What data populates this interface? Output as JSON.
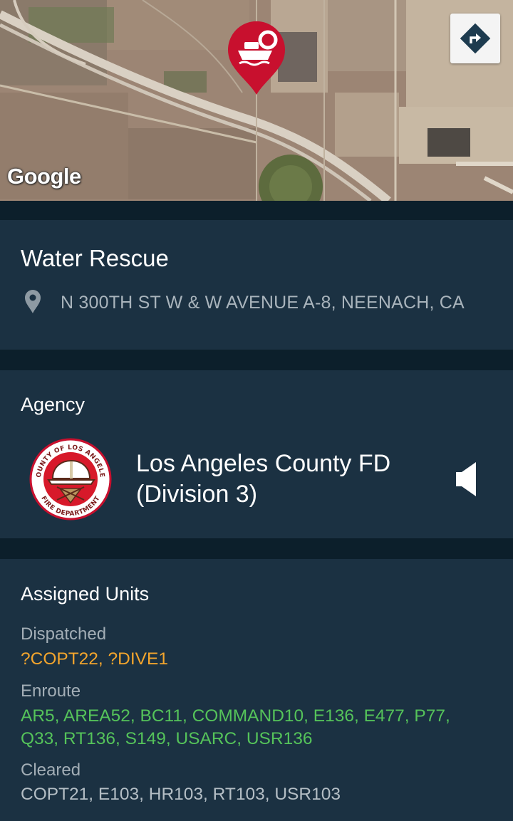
{
  "map": {
    "attribution": "Google",
    "pin_icon": "boat-lifebuoy-icon",
    "directions_icon": "directions-icon"
  },
  "incident": {
    "title": "Water Rescue",
    "location_icon": "location-pin-icon",
    "address": "N 300TH ST W & W AVENUE A-8, NEENACH, CA"
  },
  "agency": {
    "label": "Agency",
    "logo_ring_text_top": "COUNTY OF LOS ANGELES",
    "logo_ring_text_bottom": "FIRE DEPARTMENT",
    "name_line1": "Los Angeles County FD",
    "name_line2": "(Division 3)",
    "audio_icon": "speaker-icon"
  },
  "units": {
    "label": "Assigned Units",
    "dispatched": {
      "label": "Dispatched",
      "list": "?COPT22, ?DIVE1"
    },
    "enroute": {
      "label": "Enroute",
      "list": "AR5, AREA52, BC11, COMMAND10, E136, E477, P77, Q33, RT136, S149, USARC, USR136"
    },
    "cleared": {
      "label": "Cleared",
      "list": "COPT21, E103, HR103, RT103, USR103"
    }
  },
  "colors": {
    "background": "#0f2432",
    "card": "#1b3142",
    "dispatched": "#f3a52d",
    "enroute": "#55c35a",
    "cleared": "#b4bec5",
    "pin": "#c8102e"
  }
}
